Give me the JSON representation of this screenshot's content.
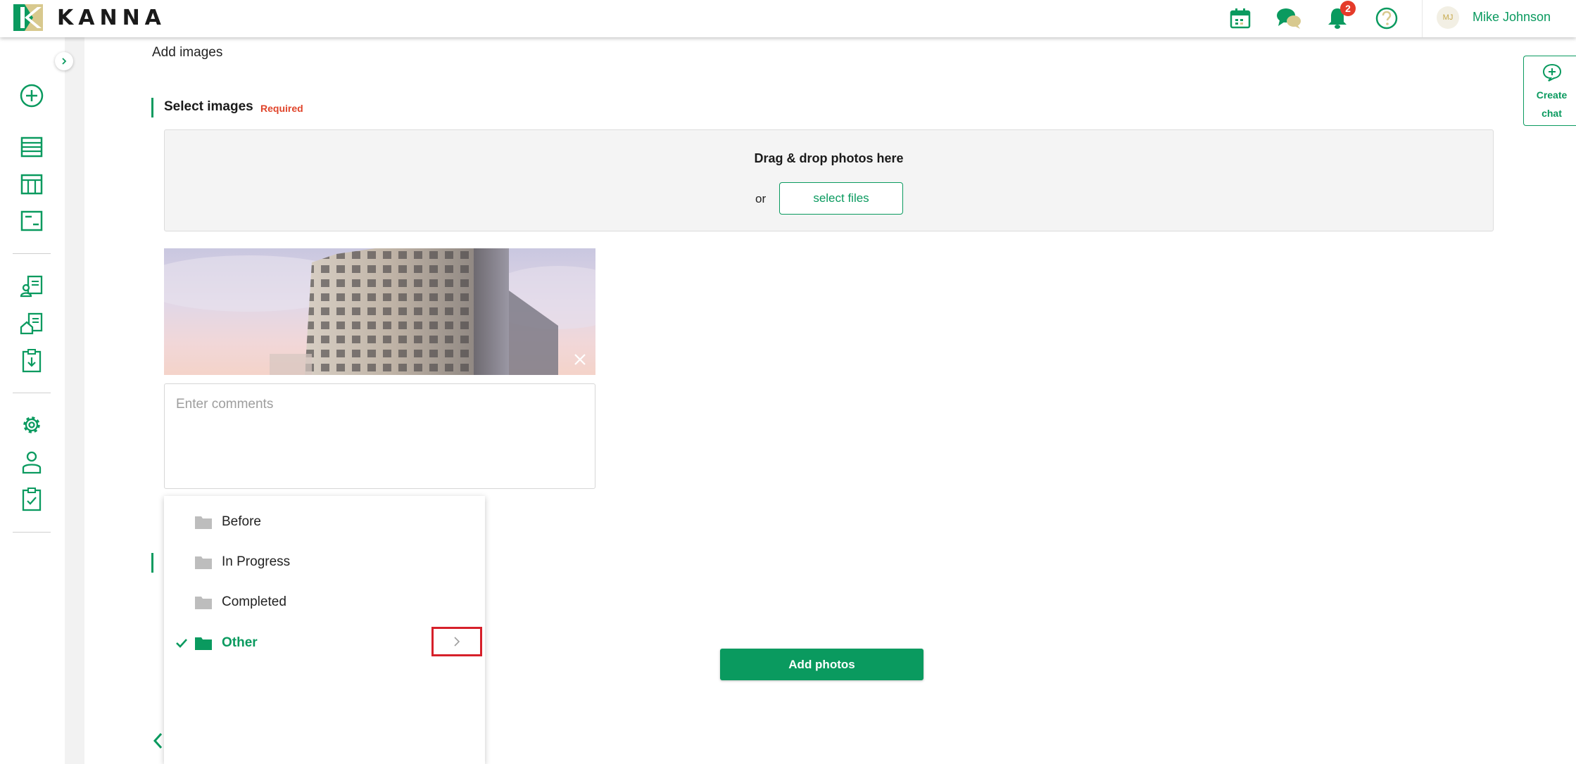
{
  "header": {
    "logo_text": "KANNA",
    "notification_count": "2",
    "avatar_initials": "MJ",
    "user_name": "Mike Johnson"
  },
  "page": {
    "title": "Add images",
    "section_title": "Select images",
    "required_label": "Required"
  },
  "dropzone": {
    "title": "Drag & drop photos here",
    "or_text": "or",
    "select_files_label": "select files"
  },
  "comments": {
    "placeholder": "Enter comments"
  },
  "folders": {
    "items": [
      {
        "label": "Before"
      },
      {
        "label": "In Progress"
      },
      {
        "label": "Completed"
      },
      {
        "label": "Other"
      }
    ],
    "selected": "Other"
  },
  "actions": {
    "add_photos_label": "Add photos"
  },
  "create_chat": {
    "line1": "Create",
    "line2": "chat"
  },
  "colors": {
    "brand_green": "#0a9a5f",
    "badge_red": "#e53b2a",
    "required_red": "#e0442a",
    "highlight_red": "#d6202a"
  },
  "icons": {
    "header": [
      "calendar-icon",
      "chat-bubbles-icon",
      "bell-icon",
      "help-icon"
    ],
    "sidebar": [
      "add-circle-icon",
      "list-icon",
      "columns-icon",
      "card-icon",
      "person-document-icon",
      "house-document-icon",
      "clipboard-download-icon",
      "gear-icon",
      "user-icon",
      "clipboard-check-icon"
    ]
  }
}
